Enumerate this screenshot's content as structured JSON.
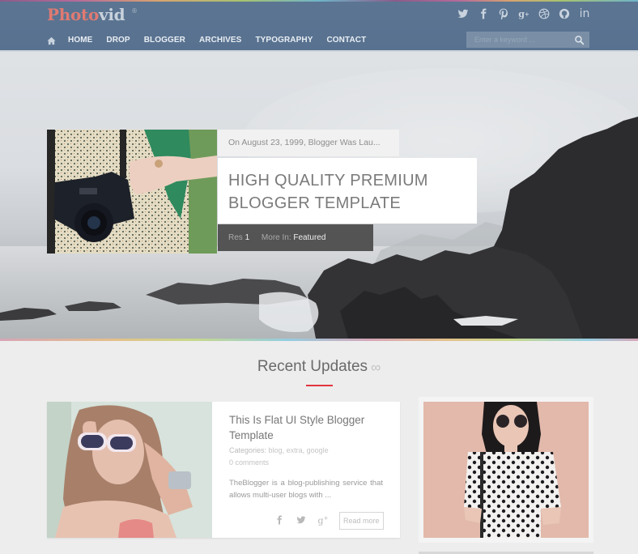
{
  "site": {
    "logo_part1": "Photo",
    "logo_part2": "vid",
    "logo_mark": "®"
  },
  "social": [
    {
      "icon": "twitter-icon",
      "glyph": "twitter"
    },
    {
      "icon": "facebook-icon",
      "glyph": "f"
    },
    {
      "icon": "pinterest-icon",
      "glyph": "P"
    },
    {
      "icon": "google-plus-icon",
      "glyph": "g+"
    },
    {
      "icon": "dribbble-icon",
      "glyph": "dribbble"
    },
    {
      "icon": "github-icon",
      "glyph": "github"
    },
    {
      "icon": "linkedin-icon",
      "glyph": "in"
    }
  ],
  "nav": {
    "home_icon": "home-icon",
    "items": [
      "HOME",
      "DROP",
      "BLOGGER",
      "ARCHIVES",
      "TYPOGRAPHY",
      "CONTACT"
    ]
  },
  "search": {
    "placeholder": "Enter a keyword ...",
    "value": "",
    "icon": "search-icon"
  },
  "featured": {
    "meta": "On August 23, 1999, Blogger Was Lau...",
    "title_line1": "HIGH QUALITY PREMIUM",
    "title_line2": "BLOGGER TEMPLATE",
    "res_label": "Res",
    "res_value": "1",
    "more_in_label": "More In:",
    "more_in_value": "Featured"
  },
  "recent": {
    "title": "Recent Updates",
    "title_icon": "infinity-icon",
    "accent": "#e2343e"
  },
  "posts": [
    {
      "title": "This Is Flat UI Style Blogger Template",
      "categories_label": "Categories:",
      "categories": [
        "blog",
        "extra",
        "google"
      ],
      "comments": "0 comments",
      "excerpt": "TheBlogger is a blog-publishing service that allows multi-user blogs with ...",
      "read_more": "Read more"
    }
  ],
  "colors": {
    "header_bg": "#5b7592",
    "logo_red": "#e07a72",
    "page_bg": "#ededed",
    "featured_footer_bg": "#555454"
  }
}
